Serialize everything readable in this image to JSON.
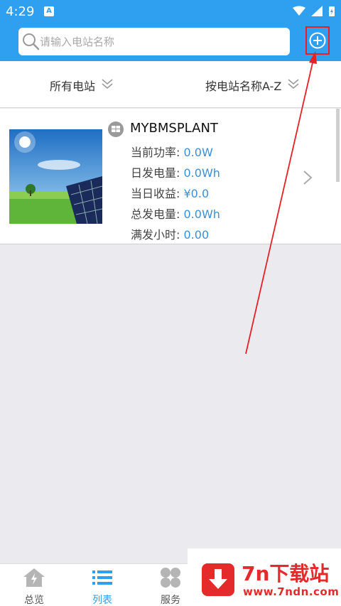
{
  "status_bar": {
    "time": "4:29",
    "a_badge": "A"
  },
  "search": {
    "placeholder": "请输入电站名称"
  },
  "filters": {
    "all": "所有电站",
    "sort": "按电站名称A-Z"
  },
  "plant": {
    "name": "MYBMSPLANT",
    "rows": [
      {
        "label": "当前功率:",
        "value": "0.0W"
      },
      {
        "label": "日发电量:",
        "value": "0.0Wh"
      },
      {
        "label": "当日收益:",
        "value": "¥0.0"
      },
      {
        "label": "总发电量:",
        "value": "0.0Wh"
      },
      {
        "label": "满发小时:",
        "value": "0.00"
      }
    ]
  },
  "tabs": [
    {
      "label": "总览",
      "icon": "home-icon"
    },
    {
      "label": "列表",
      "icon": "list-icon",
      "active": true
    },
    {
      "label": "服务",
      "icon": "service-icon"
    }
  ],
  "watermark": {
    "title": "7n下载站",
    "url": "www.7ndn.com"
  },
  "colors": {
    "accent": "#2f9ff0",
    "value": "#3a8fd8",
    "annotation": "#e62025"
  }
}
